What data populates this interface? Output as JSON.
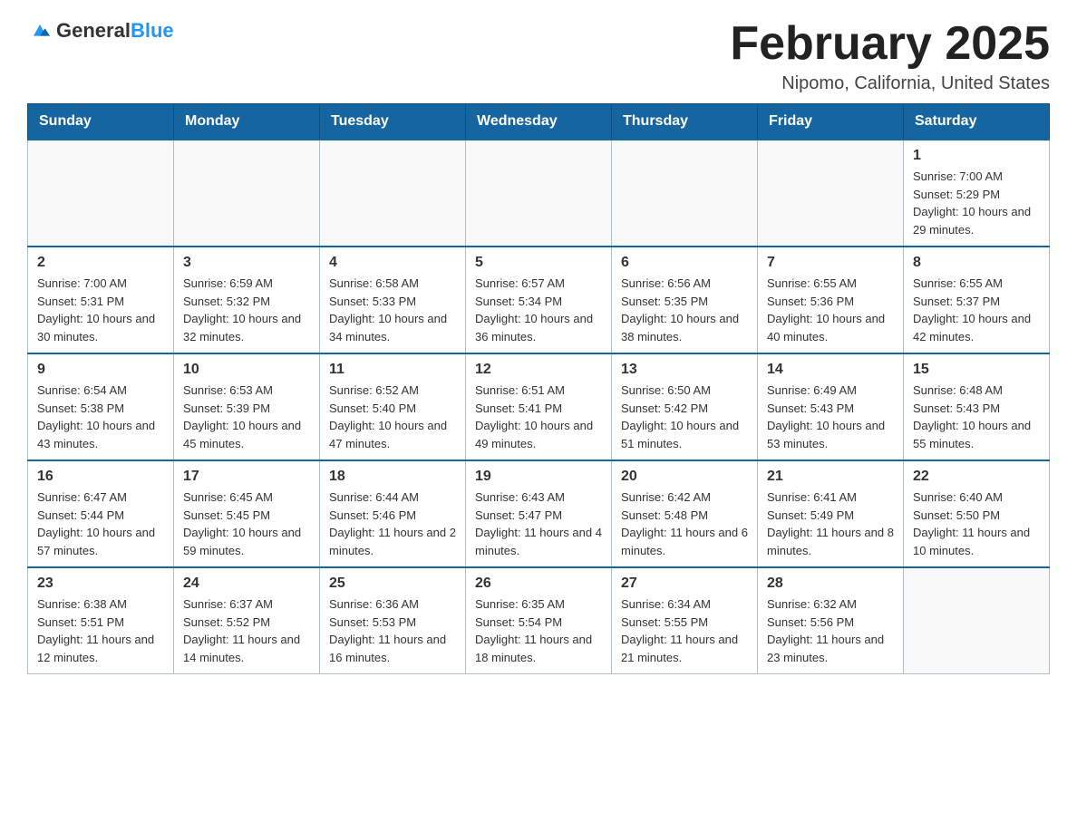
{
  "logo": {
    "general": "General",
    "blue": "Blue"
  },
  "title": "February 2025",
  "subtitle": "Nipomo, California, United States",
  "weekdays": [
    "Sunday",
    "Monday",
    "Tuesday",
    "Wednesday",
    "Thursday",
    "Friday",
    "Saturday"
  ],
  "weeks": [
    [
      {
        "day": "",
        "info": ""
      },
      {
        "day": "",
        "info": ""
      },
      {
        "day": "",
        "info": ""
      },
      {
        "day": "",
        "info": ""
      },
      {
        "day": "",
        "info": ""
      },
      {
        "day": "",
        "info": ""
      },
      {
        "day": "1",
        "info": "Sunrise: 7:00 AM\nSunset: 5:29 PM\nDaylight: 10 hours and 29 minutes."
      }
    ],
    [
      {
        "day": "2",
        "info": "Sunrise: 7:00 AM\nSunset: 5:31 PM\nDaylight: 10 hours and 30 minutes."
      },
      {
        "day": "3",
        "info": "Sunrise: 6:59 AM\nSunset: 5:32 PM\nDaylight: 10 hours and 32 minutes."
      },
      {
        "day": "4",
        "info": "Sunrise: 6:58 AM\nSunset: 5:33 PM\nDaylight: 10 hours and 34 minutes."
      },
      {
        "day": "5",
        "info": "Sunrise: 6:57 AM\nSunset: 5:34 PM\nDaylight: 10 hours and 36 minutes."
      },
      {
        "day": "6",
        "info": "Sunrise: 6:56 AM\nSunset: 5:35 PM\nDaylight: 10 hours and 38 minutes."
      },
      {
        "day": "7",
        "info": "Sunrise: 6:55 AM\nSunset: 5:36 PM\nDaylight: 10 hours and 40 minutes."
      },
      {
        "day": "8",
        "info": "Sunrise: 6:55 AM\nSunset: 5:37 PM\nDaylight: 10 hours and 42 minutes."
      }
    ],
    [
      {
        "day": "9",
        "info": "Sunrise: 6:54 AM\nSunset: 5:38 PM\nDaylight: 10 hours and 43 minutes."
      },
      {
        "day": "10",
        "info": "Sunrise: 6:53 AM\nSunset: 5:39 PM\nDaylight: 10 hours and 45 minutes."
      },
      {
        "day": "11",
        "info": "Sunrise: 6:52 AM\nSunset: 5:40 PM\nDaylight: 10 hours and 47 minutes."
      },
      {
        "day": "12",
        "info": "Sunrise: 6:51 AM\nSunset: 5:41 PM\nDaylight: 10 hours and 49 minutes."
      },
      {
        "day": "13",
        "info": "Sunrise: 6:50 AM\nSunset: 5:42 PM\nDaylight: 10 hours and 51 minutes."
      },
      {
        "day": "14",
        "info": "Sunrise: 6:49 AM\nSunset: 5:43 PM\nDaylight: 10 hours and 53 minutes."
      },
      {
        "day": "15",
        "info": "Sunrise: 6:48 AM\nSunset: 5:43 PM\nDaylight: 10 hours and 55 minutes."
      }
    ],
    [
      {
        "day": "16",
        "info": "Sunrise: 6:47 AM\nSunset: 5:44 PM\nDaylight: 10 hours and 57 minutes."
      },
      {
        "day": "17",
        "info": "Sunrise: 6:45 AM\nSunset: 5:45 PM\nDaylight: 10 hours and 59 minutes."
      },
      {
        "day": "18",
        "info": "Sunrise: 6:44 AM\nSunset: 5:46 PM\nDaylight: 11 hours and 2 minutes."
      },
      {
        "day": "19",
        "info": "Sunrise: 6:43 AM\nSunset: 5:47 PM\nDaylight: 11 hours and 4 minutes."
      },
      {
        "day": "20",
        "info": "Sunrise: 6:42 AM\nSunset: 5:48 PM\nDaylight: 11 hours and 6 minutes."
      },
      {
        "day": "21",
        "info": "Sunrise: 6:41 AM\nSunset: 5:49 PM\nDaylight: 11 hours and 8 minutes."
      },
      {
        "day": "22",
        "info": "Sunrise: 6:40 AM\nSunset: 5:50 PM\nDaylight: 11 hours and 10 minutes."
      }
    ],
    [
      {
        "day": "23",
        "info": "Sunrise: 6:38 AM\nSunset: 5:51 PM\nDaylight: 11 hours and 12 minutes."
      },
      {
        "day": "24",
        "info": "Sunrise: 6:37 AM\nSunset: 5:52 PM\nDaylight: 11 hours and 14 minutes."
      },
      {
        "day": "25",
        "info": "Sunrise: 6:36 AM\nSunset: 5:53 PM\nDaylight: 11 hours and 16 minutes."
      },
      {
        "day": "26",
        "info": "Sunrise: 6:35 AM\nSunset: 5:54 PM\nDaylight: 11 hours and 18 minutes."
      },
      {
        "day": "27",
        "info": "Sunrise: 6:34 AM\nSunset: 5:55 PM\nDaylight: 11 hours and 21 minutes."
      },
      {
        "day": "28",
        "info": "Sunrise: 6:32 AM\nSunset: 5:56 PM\nDaylight: 11 hours and 23 minutes."
      },
      {
        "day": "",
        "info": ""
      }
    ]
  ]
}
